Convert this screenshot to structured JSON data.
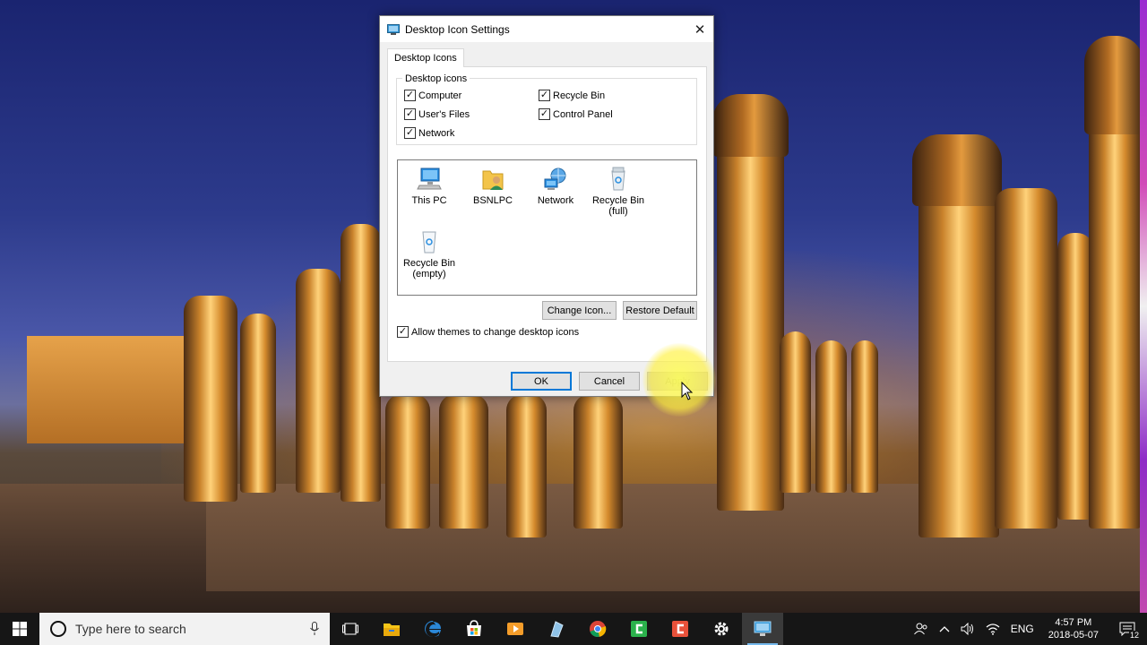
{
  "dialog": {
    "title": "Desktop Icon Settings",
    "tab_label": "Desktop Icons",
    "group_label": "Desktop icons",
    "checkboxes": [
      {
        "label": "Computer",
        "checked": true
      },
      {
        "label": "User's Files",
        "checked": true
      },
      {
        "label": "Network",
        "checked": true
      },
      {
        "label": "Recycle Bin",
        "checked": true
      },
      {
        "label": "Control Panel",
        "checked": true
      }
    ],
    "icons": [
      {
        "label": "This PC",
        "icon": "computer-icon"
      },
      {
        "label": "BSNLPC",
        "icon": "user-folder-icon"
      },
      {
        "label": "Network",
        "icon": "network-icon"
      },
      {
        "label": "Recycle Bin\n(full)",
        "icon": "recycle-bin-full-icon"
      },
      {
        "label": "Recycle Bin\n(empty)",
        "icon": "recycle-bin-empty-icon"
      }
    ],
    "change_icon_label": "Change Icon...",
    "restore_default_label": "Restore Default",
    "allow_themes_label": "Allow themes to change desktop icons",
    "allow_themes_checked": true,
    "ok_label": "OK",
    "cancel_label": "Cancel",
    "apply_label": "Apply",
    "close_glyph": "✕"
  },
  "taskbar": {
    "search_placeholder": "Type here to search",
    "apps": [
      {
        "name": "task-view-icon"
      },
      {
        "name": "file-explorer-icon",
        "color": "#f5c518"
      },
      {
        "name": "edge-icon",
        "color": "#2b88d8"
      },
      {
        "name": "store-icon",
        "color": "#ffffff"
      },
      {
        "name": "media-player-icon",
        "color": "#f59d2a"
      },
      {
        "name": "paint-icon",
        "color": "#8fc3e8"
      },
      {
        "name": "chrome-icon",
        "color": "#db4437"
      },
      {
        "name": "camtasia-green-icon",
        "color": "#2bb24c"
      },
      {
        "name": "camtasia-red-icon",
        "color": "#e8513a"
      },
      {
        "name": "settings-icon",
        "color": "#ffffff"
      },
      {
        "name": "desktop-icon-settings-app-icon",
        "color": "#3a9bd9"
      }
    ],
    "language": "ENG",
    "time": "4:57 PM",
    "date": "2018-05-07",
    "notification_count": "12"
  },
  "colors": {
    "accent": "#0078d7",
    "taskbar": "#161616",
    "cursor_highlight": "#ffff50"
  }
}
